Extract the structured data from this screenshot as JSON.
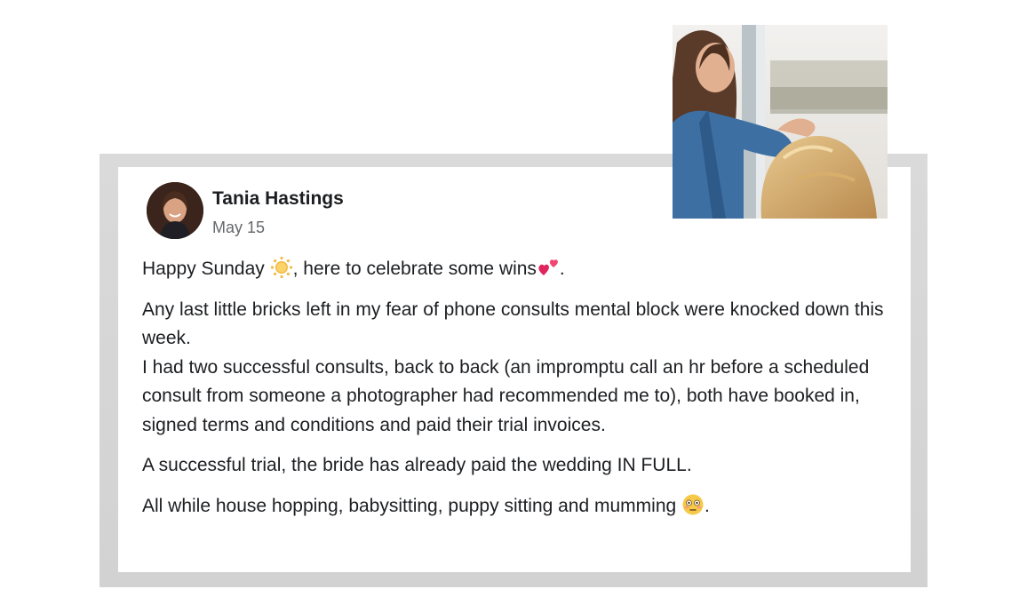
{
  "post": {
    "author": "Tania Hastings",
    "date": "May 15",
    "paragraphs": {
      "p1_a": "Happy Sunday ",
      "p1_b": ", here to celebrate some wins",
      "p1_c": ".",
      "p2": "Any last little bricks left in my fear of phone consults mental block were knocked down this week.",
      "p3": "I had two successful consults, back to back (an impromptu call an hr before a scheduled consult from someone a photographer had recommended me to), both have booked in, signed terms and conditions and paid their trial invoices.",
      "p4": "A successful trial, the bride has already paid the wedding IN FULL.",
      "p5_a": "All while house hopping, babysitting, puppy sitting and mumming ",
      "p5_b": "."
    },
    "emoji_icons": [
      "sun-emoji-icon",
      "two-hearts-emoji-icon",
      "flushed-face-emoji-icon"
    ]
  },
  "colors": {
    "frame": "#d6d6d6",
    "card": "#ffffff",
    "name_text": "#1c1e21",
    "date_text": "#65676b"
  }
}
